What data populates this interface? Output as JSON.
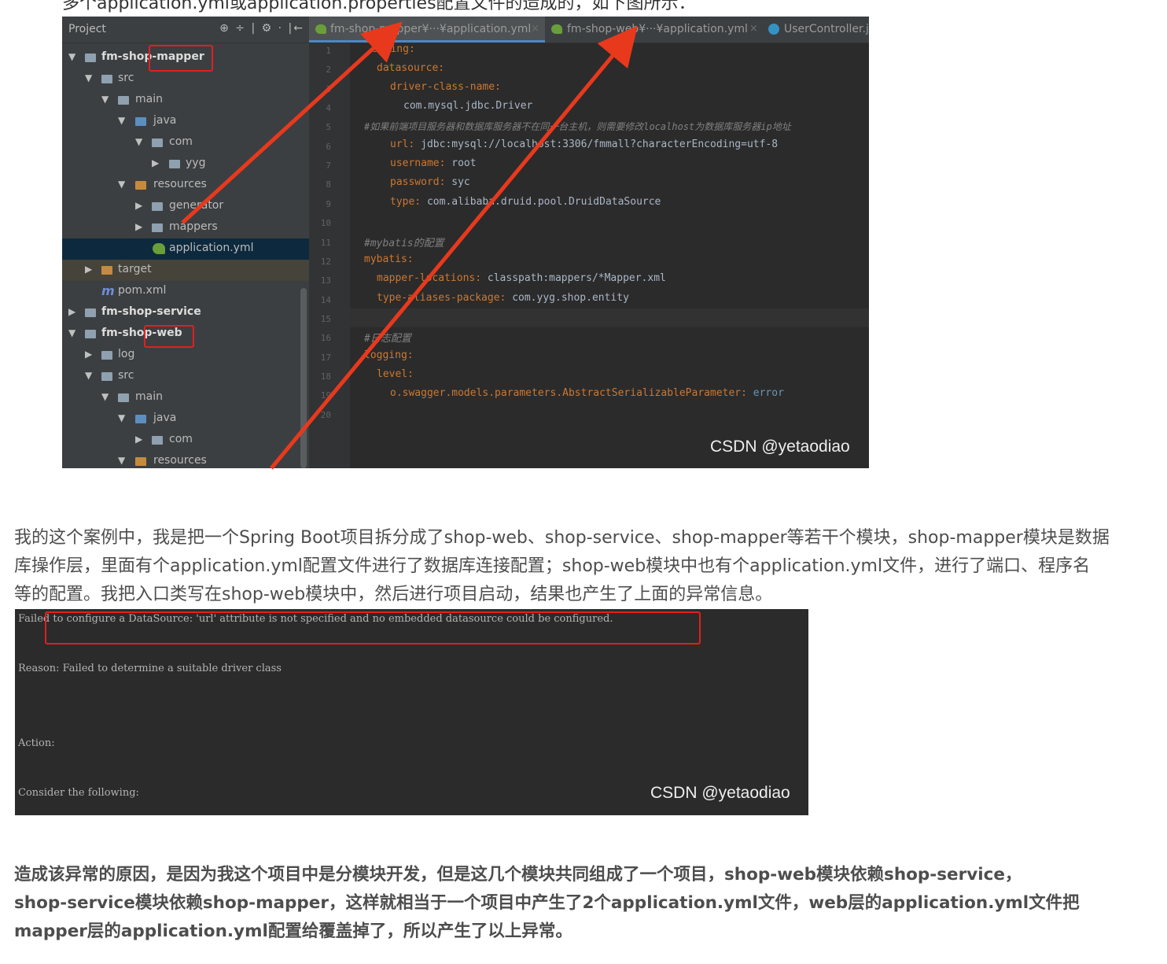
{
  "intro_line": "多个application.yml或application.properties配置文件的造成的，如下图所示：",
  "ide": {
    "project_title": "Project",
    "project_tools": "⊕ ÷ | ⚙ · |←",
    "tree": [
      {
        "label": "fm-shop-mapper"
      },
      {
        "label": "src"
      },
      {
        "label": "main"
      },
      {
        "label": "java"
      },
      {
        "label": "com"
      },
      {
        "label": "yyg"
      },
      {
        "label": "resources"
      },
      {
        "label": "generator"
      },
      {
        "label": "mappers"
      },
      {
        "label": "application.yml"
      },
      {
        "label": "target"
      },
      {
        "label": "pom.xml"
      },
      {
        "label": "fm-shop-service"
      },
      {
        "label": "fm-shop-web"
      },
      {
        "label": "log"
      },
      {
        "label": "src"
      },
      {
        "label": "main"
      },
      {
        "label": "java"
      },
      {
        "label": "com"
      },
      {
        "label": "resources"
      }
    ],
    "tabs": [
      {
        "label": "fm-shop-mapper¥···¥application.yml"
      },
      {
        "label": "fm-shop-web¥···¥application.yml"
      },
      {
        "label": "UserController.j"
      }
    ],
    "line_numbers": [
      "1",
      "2",
      "3",
      "4",
      "5",
      "6",
      "7",
      "8",
      "9",
      "10",
      "11",
      "12",
      "13",
      "14",
      "15",
      "16",
      "17",
      "18",
      "19",
      "20"
    ],
    "code": {
      "l1": "spring:",
      "l2": "datasource:",
      "l3": "driver-class-name:",
      "l4": "com.mysql.jdbc.Driver",
      "l5": "#如果前端项目服务器和数据库服务器不在同一台主机，则需要修改localhost为数据库服务器ip地址",
      "l6_key": "url:",
      "l6_val": "jdbc:mysql://localhost:3306/fmmall?characterEncoding=utf-8",
      "l7_key": "username:",
      "l7_val": "root",
      "l8_key": "password:",
      "l8_val": "syc",
      "l9_key": "type:",
      "l9_val": "com.alibaba.druid.pool.DruidDataSource",
      "l11": "#mybatis的配置",
      "l12": "mybatis:",
      "l13_key": "mapper-locations:",
      "l13_val": "classpath:mappers/*Mapper.xml",
      "l14_key": "type-aliases-package:",
      "l14_val": "com.yyg.shop.entity",
      "l16": "#日志配置",
      "l17": "logging:",
      "l18": "level:",
      "l19_key": "o.swagger.models.parameters.AbstractSerializableParameter:",
      "l19_val": "error"
    },
    "watermark": "CSDN @yetaodiao"
  },
  "paragraph1": [
    "我的这个案例中，我是把一个Spring Boot项目拆分成了shop-web、shop-service、shop-mapper等若干个模块，shop-mapper模块是数据",
    "库操作层，里面有个application.yml配置文件进行了数据库连接配置；shop-web模块中也有个application.yml文件，进行了端口、程序名",
    "等的配置。我把入口类写在shop-web模块中，然后进行项目启动，结果也产生了上面的异常信息。"
  ],
  "console": {
    "line1": "Failed to configure a DataSource: 'url' attribute is not specified and no embedded datasource could be configured.",
    "line2": "Reason: Failed to determine a suitable driver class",
    "line3": "Action:",
    "line4": "Consider the following:",
    "watermark": "CSDN @yetaodiao"
  },
  "paragraph2": [
    "造成该异常的原因，是因为我这个项目中是分模块开发，但是这几个模块共同组成了一个项目，shop-web模块依赖shop-service，",
    "shop-service模块依赖shop-mapper，这样就相当于一个项目中产生了2个application.yml文件，web层的application.yml文件把",
    "mapper层的application.yml配置给覆盖掉了，所以产生了以上异常。"
  ]
}
